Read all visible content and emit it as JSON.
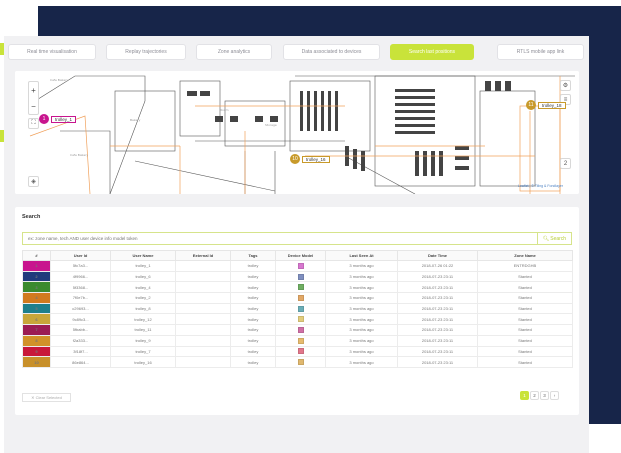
{
  "tabs": [
    {
      "label": "Real time visualisation",
      "active": false
    },
    {
      "label": "Replay trajectories",
      "active": false
    },
    {
      "label": "Zone analytics",
      "active": false
    },
    {
      "label": "Data associated to devices",
      "active": false
    },
    {
      "label": "Search last positions",
      "active": true
    },
    {
      "label": "RTLS mobile app link",
      "active": false
    }
  ],
  "map": {
    "zoom_in": "+",
    "zoom_out": "−",
    "markers": [
      {
        "number": "1",
        "label": "trolley_1",
        "color": "#c8158e"
      },
      {
        "number": "10",
        "label": "trolley_16",
        "color": "#c89a2a"
      },
      {
        "number": "11",
        "label": "trolley_18",
        "color": "#c89a2a"
      }
    ],
    "side_count": "2",
    "attribution": "Leaflet | © Tiling & Fondlayer"
  },
  "search": {
    "title": "Search",
    "placeholder": "ex: zone name, tech AND user device info model token",
    "button": "Search"
  },
  "table": {
    "columns": [
      "#",
      "User Id",
      "User Name",
      "External Id",
      "Tags",
      "Device Model",
      "Last Seen At",
      "Date Time",
      "Zone Name"
    ],
    "rows": [
      {
        "num": "1",
        "color": "#c8158e",
        "user_id": "5fc7a3...",
        "user_name": "trolley_1",
        "external_id": "",
        "tags": "trolley",
        "model_color": "#d777cf",
        "last_seen": "3 months ago",
        "date_time": "2018-07-26 01:22",
        "zone": "ENTRDGHB"
      },
      {
        "num": "2",
        "color": "#203a7c",
        "user_id": "4f9966...",
        "user_name": "trolley_6",
        "external_id": "",
        "tags": "trolley",
        "model_color": "#7f8fbf",
        "last_seen": "3 months ago",
        "date_time": "2018-07-23 23:11",
        "zone": "Stanted"
      },
      {
        "num": "3",
        "color": "#3a8a2e",
        "user_id": "5f3368...",
        "user_name": "trolley_4",
        "external_id": "",
        "tags": "trolley",
        "model_color": "#6fae62",
        "last_seen": "3 months ago",
        "date_time": "2018-07-23 23:11",
        "zone": "Stanted"
      },
      {
        "num": "4",
        "color": "#d17a1e",
        "user_id": "7f0e7b...",
        "user_name": "trolley_2",
        "external_id": "",
        "tags": "trolley",
        "model_color": "#e2a866",
        "last_seen": "3 months ago",
        "date_time": "2018-07-23 23:11",
        "zone": "Stanted"
      },
      {
        "num": "5",
        "color": "#1e7f8c",
        "user_id": "c29693...",
        "user_name": "trolley_8",
        "external_id": "",
        "tags": "trolley",
        "model_color": "#6aaeb7",
        "last_seen": "3 months ago",
        "date_time": "2018-07-23 23:11",
        "zone": "Stanted"
      },
      {
        "num": "6",
        "color": "#c8a63a",
        "user_id": "9c89c3...",
        "user_name": "trolley_12",
        "external_id": "",
        "tags": "trolley",
        "model_color": "#e3cd7c",
        "last_seen": "3 months ago",
        "date_time": "2018-07-23 23:11",
        "zone": "Stanted"
      },
      {
        "num": "7",
        "color": "#9b1c54",
        "user_id": "5fbabb...",
        "user_name": "trolley_11",
        "external_id": "",
        "tags": "trolley",
        "model_color": "#d070a6",
        "last_seen": "3 months ago",
        "date_time": "2018-07-23 23:11",
        "zone": "Stanted"
      },
      {
        "num": "8",
        "color": "#d1922a",
        "user_id": "f2a333...",
        "user_name": "trolley_9",
        "external_id": "",
        "tags": "trolley",
        "model_color": "#e7bb6e",
        "last_seen": "3 months ago",
        "date_time": "2018-07-23 23:11",
        "zone": "Stanted"
      },
      {
        "num": "9",
        "color": "#c8183a",
        "user_id": "3f18f7...",
        "user_name": "trolley_7",
        "external_id": "",
        "tags": "trolley",
        "model_color": "#e2778b",
        "last_seen": "3 months ago",
        "date_time": "2018-07-23 23:11",
        "zone": "Stanted"
      },
      {
        "num": "10",
        "color": "#c8902a",
        "user_id": "86e864...",
        "user_name": "trolley_16",
        "external_id": "",
        "tags": "trolley",
        "model_color": "#e0b86e",
        "last_seen": "3 months ago",
        "date_time": "2018-07-23 23:11",
        "zone": "Stanted"
      }
    ]
  },
  "footer": {
    "clear_label": "✕ Clear Selected",
    "pages": [
      "1",
      "2",
      "3",
      "›"
    ],
    "active_page": "1"
  },
  "colors": {
    "accent": "#c9e33a",
    "navy": "#172549",
    "floorplan_line": "#555555",
    "floorplan_orange": "#f0a05a"
  }
}
